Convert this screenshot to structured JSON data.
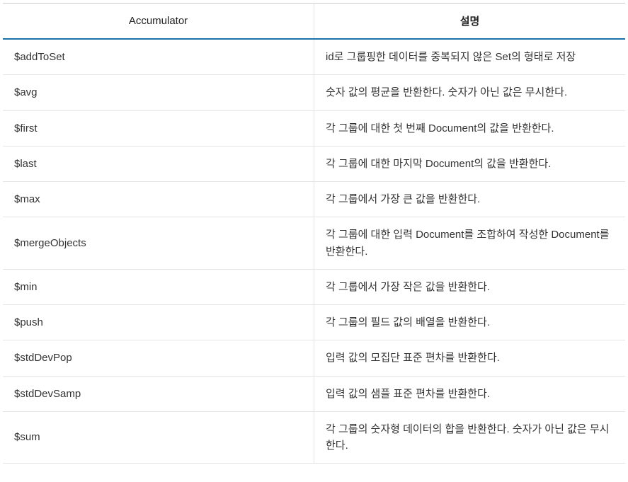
{
  "table": {
    "headers": {
      "accumulator": "Accumulator",
      "description": "설명"
    },
    "rows": [
      {
        "accumulator": "$addToSet",
        "description": "id로 그룹핑한 데이터를 중복되지 않은 Set의 형태로 저장"
      },
      {
        "accumulator": "$avg",
        "description": "숫자 값의 평균을 반환한다. 숫자가 아닌 값은 무시한다."
      },
      {
        "accumulator": "$first",
        "description": "각 그룹에 대한 첫 번째 Document의 값을 반환한다."
      },
      {
        "accumulator": "$last",
        "description": "각 그룹에 대한 마지막 Document의 값을 반환한다."
      },
      {
        "accumulator": "$max",
        "description": "각 그룹에서 가장 큰 값을 반환한다."
      },
      {
        "accumulator": "$mergeObjects",
        "description": "각 그룹에 대한 입력 Document를 조합하여 작성한 Document를 반환한다."
      },
      {
        "accumulator": "$min",
        "description": "각 그룹에서 가장 작은 값을 반환한다."
      },
      {
        "accumulator": "$push",
        "description": "각 그룹의 필드 값의 배열을 반환한다."
      },
      {
        "accumulator": "$stdDevPop",
        "description": "입력 값의 모집단 표준 편차를 반환한다."
      },
      {
        "accumulator": "$stdDevSamp",
        "description": "입력 값의 샘플 표준 편차를 반환한다."
      },
      {
        "accumulator": "$sum",
        "description": "각 그룹의 숫자형 데이터의 합을 반환한다. 숫자가 아닌 값은 무시한다."
      }
    ]
  }
}
